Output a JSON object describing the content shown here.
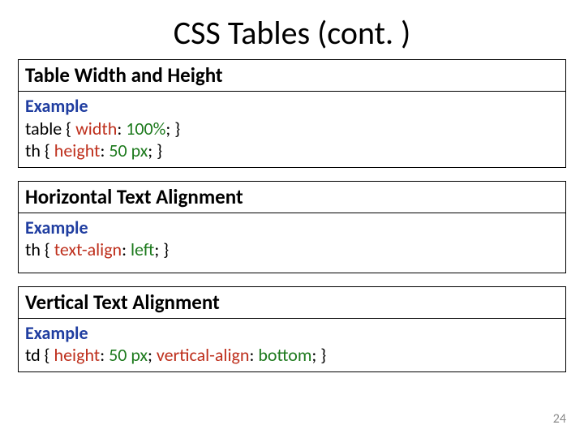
{
  "title": "CSS Tables (cont. )",
  "page_number": "24",
  "sections": [
    {
      "heading": "Table Width and Height",
      "example_label": "Example",
      "lines": [
        {
          "pre": "table { ",
          "prop": "width",
          "post_prop": ": ",
          "val": "100%",
          "post_val": "; }"
        },
        {
          "pre": "th { ",
          "prop": "height",
          "post_prop": ": ",
          "val": "50 px",
          "post_val": "; }"
        }
      ]
    },
    {
      "heading": "Horizontal Text Alignment",
      "example_label": "Example",
      "lines": [
        {
          "pre": "th { ",
          "prop": "text-align",
          "post_prop": ": ",
          "val": "left",
          "post_val": "; }"
        }
      ]
    },
    {
      "heading": "Vertical Text Alignment",
      "example_label": "Example",
      "lines": [
        {
          "pre": "td { ",
          "prop": "height",
          "post_prop": ": ",
          "val": "50 px",
          "post_val": "; ",
          "prop2": "vertical-align",
          "post_prop2": ": ",
          "val2": "bottom",
          "post_val2": "; }"
        }
      ]
    }
  ]
}
